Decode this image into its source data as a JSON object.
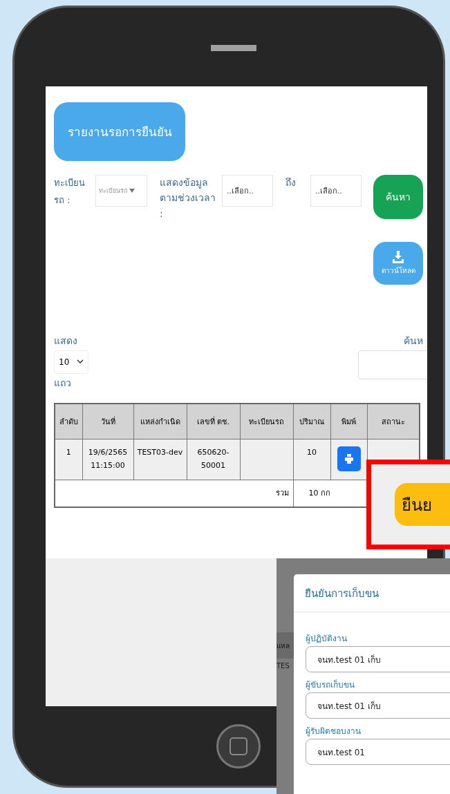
{
  "report_button": "รายงานรอการยืนยัน",
  "filters": {
    "plate_label": "ทะเบียน รถ :",
    "plate_placeholder": "ทะเบียนรถ",
    "period_label": "แสดงข้อมูล ตามช่วงเวลา :",
    "from_placeholder": "..เลือก..",
    "to_label": "ถึง",
    "to_placeholder": "..เลือก..",
    "search_button": "ค้นหา"
  },
  "download_button": "ดาวน์โหลด",
  "page_length": {
    "label_before": "แสดง",
    "value": "10",
    "label_after": "แถว"
  },
  "search_label": "ค้นห",
  "table": {
    "columns": [
      "ลำดับ",
      "วันที่",
      "แหล่งกำเนิด",
      "เลขที่ ตช.",
      "ทะเบียนรถ",
      "ปริมาณ",
      "พิมพ์",
      "สถานะ"
    ],
    "rows": [
      {
        "cells": [
          "1",
          "19/6/2565 11:15:00",
          "TEST03-dev",
          "650620-50001",
          "",
          "10"
        ]
      }
    ],
    "total_label": "รวม",
    "total_value": "10 กก"
  },
  "callout": {
    "button": "ยืนย"
  },
  "modal": {
    "background_fragments": [
      "แหล",
      "TES"
    ],
    "title": "ยืนยันการเก็บขน",
    "fields": [
      {
        "label": "ผู้ปฏิบัติงาน",
        "value": "จนท.test 01 เก็บ"
      },
      {
        "label": "ผู้ขับรถเก็บขน",
        "value": "จนท.test 01 เก็บ"
      },
      {
        "label": "ผู้รับผิดชอบงาน",
        "value": "จนท.test 01"
      }
    ]
  }
}
